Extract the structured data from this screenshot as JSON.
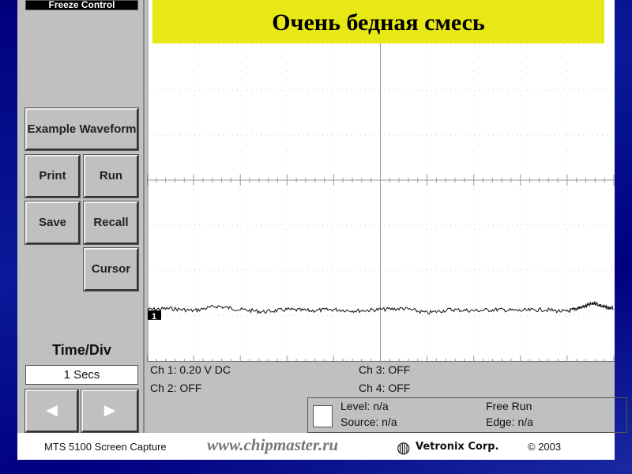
{
  "slide_title": "Очень бедная смесь",
  "sidebar": {
    "freeze_control": "Freeze Control",
    "example_waveform": "Example Waveform",
    "print": "Print",
    "run": "Run",
    "save": "Save",
    "recall": "Recall",
    "cursor": "Cursor",
    "time_div_label": "Time/Div",
    "time_div_value": "1 Secs",
    "prev": "◄",
    "next": "►"
  },
  "channels": {
    "ch1": "Ch 1: 0.20 V DC",
    "ch2": "Ch 2: OFF",
    "ch3": "Ch 3: OFF",
    "ch4": "Ch 4: OFF"
  },
  "trigger": {
    "level": "Level: n/a",
    "source": "Source: n/a",
    "mode": "Free Run",
    "edge": "Edge: n/a"
  },
  "footer": {
    "capture": "MTS 5100 Screen Capture",
    "url": "www.chipmaster.ru",
    "brand": "Vetronix Corp.",
    "copyright": "© 2003"
  },
  "chart_data": {
    "type": "line",
    "title": "Очень бедная смесь",
    "channel_marker": "1",
    "xlabel": "Time (1 s/div)",
    "ylabel": "Ch 1 (0.20 V/div)",
    "xlim": [
      0,
      10
    ],
    "ylim": [
      -0.8,
      0.8
    ],
    "grid": true,
    "series": [
      {
        "name": "Ch 1",
        "x": [
          0,
          0.5,
          1,
          1.5,
          2,
          2.5,
          3,
          3.5,
          4,
          4.5,
          5,
          5.5,
          6,
          6.5,
          7,
          7.5,
          8,
          8.5,
          9,
          9.2,
          9.4,
          9.6,
          9.8,
          10
        ],
        "values": [
          -0.575,
          -0.57,
          -0.58,
          -0.56,
          -0.575,
          -0.585,
          -0.575,
          -0.58,
          -0.575,
          -0.58,
          -0.575,
          -0.57,
          -0.59,
          -0.575,
          -0.58,
          -0.575,
          -0.58,
          -0.575,
          -0.585,
          -0.57,
          -0.56,
          -0.545,
          -0.565,
          -0.57
        ]
      }
    ]
  }
}
